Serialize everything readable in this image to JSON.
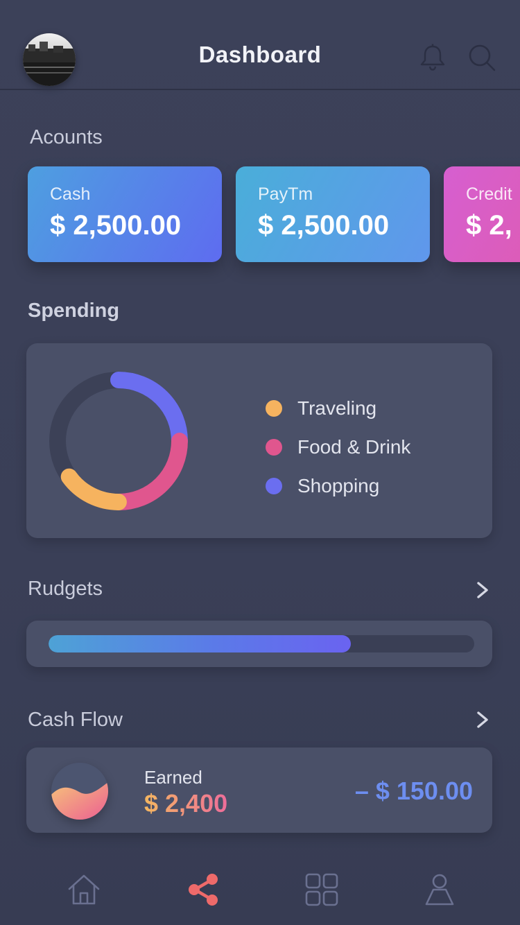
{
  "header": {
    "title": "Dashboard",
    "avatar_icon": "user-photo",
    "notification_icon": "bell-icon",
    "search_icon": "search-icon"
  },
  "accounts": {
    "heading": "Acounts",
    "items": [
      {
        "label": "Cash",
        "amount": "$ 2,500.00"
      },
      {
        "label": "PayTm",
        "amount": "$ 2,500.00"
      },
      {
        "label": "Credit",
        "amount": "$ 2,"
      }
    ]
  },
  "spending": {
    "heading": "Spending",
    "legend": [
      {
        "label": "Traveling",
        "color": "#f6b35f"
      },
      {
        "label": "Food & Drink",
        "color": "#e0568e"
      },
      {
        "label": "Shopping",
        "color": "#6b6ef0"
      }
    ]
  },
  "chart_data": {
    "type": "pie",
    "variant": "donut",
    "categories": [
      "Shopping",
      "Food & Drink",
      "Traveling"
    ],
    "values": [
      25,
      25,
      15
    ],
    "colors": [
      "#6b6ef0",
      "#e0568e",
      "#f6b35f"
    ],
    "remainder_color": "#3c4157"
  },
  "budgets": {
    "heading": "Rudgets",
    "progress": 0.71
  },
  "cash_flow": {
    "heading": "Cash Flow",
    "earned_label": "Earned",
    "earned_amount": "$ 2,400",
    "net_amount": "– $ 150.00"
  },
  "tabbar": {
    "items": [
      "home-icon",
      "share-icon",
      "grid-icon",
      "profile-icon"
    ],
    "active_color": "#ee6a6a",
    "inactive_color": "#6a7090"
  }
}
